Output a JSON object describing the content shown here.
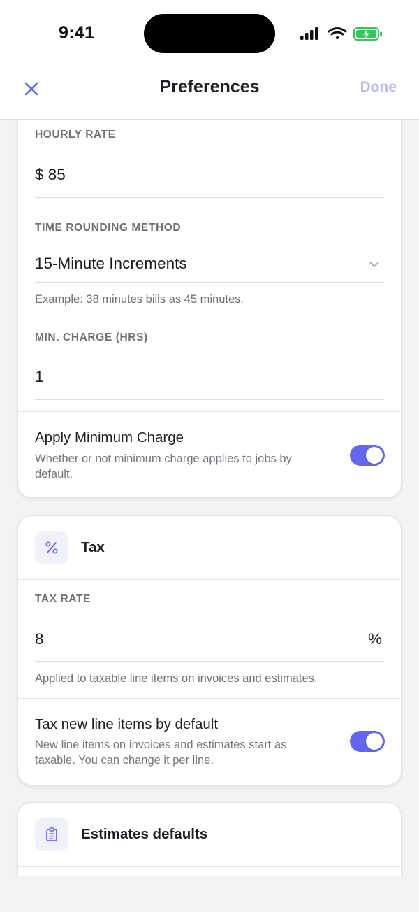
{
  "status_bar": {
    "time": "9:41"
  },
  "nav": {
    "title": "Preferences",
    "done_label": "Done"
  },
  "rates": {
    "hourly_rate_label": "HOURLY RATE",
    "hourly_rate_value": "$ 85",
    "rounding_label": "TIME ROUNDING METHOD",
    "rounding_value": "15-Minute Increments",
    "rounding_example": "Example: 38 minutes bills as 45 minutes.",
    "min_charge_label": "MIN. CHARGE (HRS)",
    "min_charge_value": "1",
    "apply_min_title": "Apply Minimum Charge",
    "apply_min_desc_1": "Whether or not minimum charge applies to jobs by",
    "apply_min_desc_2": "default.",
    "apply_min_enabled": true
  },
  "tax": {
    "title": "Tax",
    "icon": "percent-icon",
    "rate_label": "TAX RATE",
    "rate_value": "8",
    "rate_suffix": "%",
    "rate_helper": "Applied to taxable line items on invoices and estimates.",
    "default_title": "Tax new line items by default",
    "default_desc_1": "New line items on invoices and estimates start as",
    "default_desc_2": "taxable. You can change it per line.",
    "default_enabled": true
  },
  "estimates": {
    "title": "Estimates defaults",
    "icon": "clipboard-icon"
  },
  "colors": {
    "accent": "#6366f1",
    "done_disabled": "#b9bdee",
    "battery": "#34c759"
  }
}
